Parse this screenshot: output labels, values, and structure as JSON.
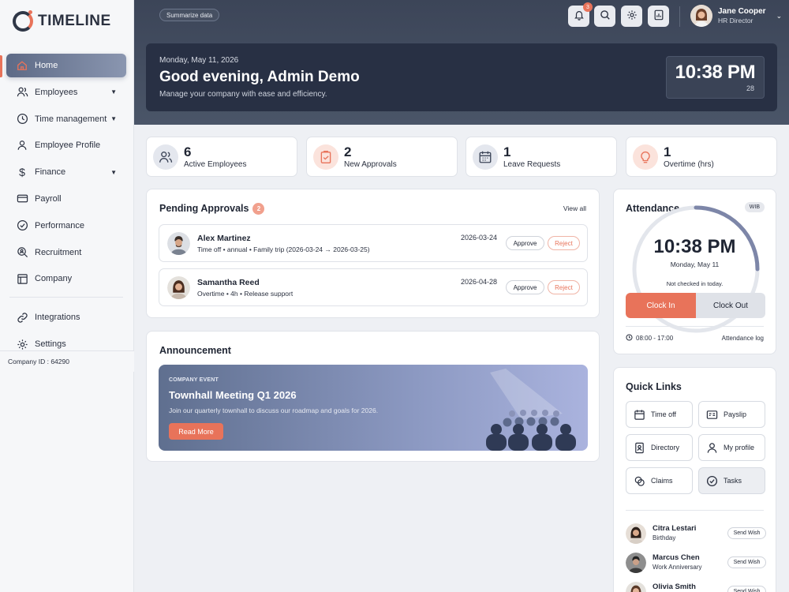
{
  "app": {
    "name": "TIMELINE"
  },
  "sidebar": {
    "items": [
      {
        "label": "Home",
        "icon": "home-icon",
        "active": true
      },
      {
        "label": "Employees",
        "icon": "users-icon",
        "has_caret": true
      },
      {
        "label": "Time management",
        "icon": "clock-icon",
        "has_caret": true
      },
      {
        "label": "Employee Profile",
        "icon": "user-icon"
      },
      {
        "label": "Finance",
        "icon": "dollar-icon",
        "has_caret": true
      },
      {
        "label": "Payroll",
        "icon": "card-icon"
      },
      {
        "label": "Performance",
        "icon": "check-circle-icon"
      },
      {
        "label": "Recruitment",
        "icon": "search-user-icon"
      },
      {
        "label": "Company",
        "icon": "building-icon"
      },
      {
        "label": "Integrations",
        "icon": "link-icon"
      },
      {
        "label": "Settings",
        "icon": "gear-icon"
      }
    ],
    "company_id": "Company ID : 64290"
  },
  "header": {
    "summarize_label": "Summarize data",
    "notification_count": "3",
    "user": {
      "name": "Jane Cooper",
      "role": "HR Director"
    }
  },
  "welcome": {
    "date": "Monday, May 11, 2026",
    "title": "Good evening, Admin Demo",
    "subtitle": "Manage your company with ease and efficiency.",
    "clock_time": "10:38 PM",
    "clock_seconds": "28"
  },
  "stats": [
    {
      "value": "6",
      "label": "Active Employees"
    },
    {
      "value": "2",
      "label": "New Approvals"
    },
    {
      "value": "1",
      "label": "Leave Requests"
    },
    {
      "value": "1",
      "label": "Overtime (hrs)"
    }
  ],
  "approvals": {
    "title": "Pending Approvals",
    "count": "2",
    "view_all": "View all",
    "approve_label": "Approve",
    "reject_label": "Reject",
    "rows": [
      {
        "name": "Alex Martinez",
        "desc": "Time off • annual • Family trip (2026-03-24 → 2026-03-25)",
        "date": "2026-03-24"
      },
      {
        "name": "Samantha Reed",
        "desc": "Overtime • 4h • Release support",
        "date": "2026-04-28"
      }
    ]
  },
  "announcement": {
    "title": "Announcement",
    "tag": "COMPANY EVENT",
    "headline": "Townhall Meeting Q1 2026",
    "body": "Join our quarterly townhall to discuss our roadmap and goals for 2026.",
    "cta": "Read More"
  },
  "attendance": {
    "title": "Attendance",
    "timezone": "WIB",
    "time": "10:38 PM",
    "date": "Monday, May 11",
    "status": "Not checked in today.",
    "clock_in": "Clock In",
    "clock_out": "Clock Out",
    "hours": "08:00 - 17:00",
    "log_link": "Attendance log"
  },
  "quick_links": {
    "title": "Quick Links",
    "items": [
      {
        "label": "Time off",
        "icon": "calendar-icon"
      },
      {
        "label": "Payslip",
        "icon": "payslip-icon"
      },
      {
        "label": "Directory",
        "icon": "directory-icon"
      },
      {
        "label": "My profile",
        "icon": "profile-icon"
      },
      {
        "label": "Claims",
        "icon": "claims-icon"
      },
      {
        "label": "Tasks",
        "icon": "tasks-icon"
      }
    ]
  },
  "celebrations": {
    "send_label": "Send Wish",
    "items": [
      {
        "name": "Citra Lestari",
        "type": "Birthday"
      },
      {
        "name": "Marcus Chen",
        "type": "Work Anniversary"
      },
      {
        "name": "Olivia Smith",
        "type": ""
      }
    ]
  },
  "colors": {
    "accent": "#e8735a",
    "header_bg": "#3c4558",
    "welcome_bg": "#283044"
  }
}
